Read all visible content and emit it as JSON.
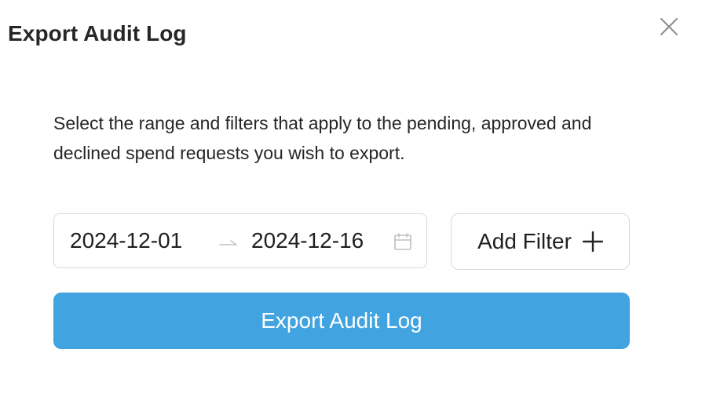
{
  "modal": {
    "title": "Export Audit Log",
    "close_icon": "close-icon"
  },
  "description": "Select the range and filters that apply to the pending, approved and declined spend requests you wish to export.",
  "date_range": {
    "start": "2024-12-01",
    "end": "2024-12-16",
    "separator_icon": "arrow-right-icon",
    "calendar_icon": "calendar-icon"
  },
  "filter": {
    "add_label": "Add Filter",
    "add_icon": "plus-icon"
  },
  "actions": {
    "export_label": "Export Audit Log"
  },
  "colors": {
    "primary": "#41a3e0",
    "border": "#d9d9d9",
    "text": "#1f1f1f",
    "muted_icon": "#bfbfbf"
  }
}
